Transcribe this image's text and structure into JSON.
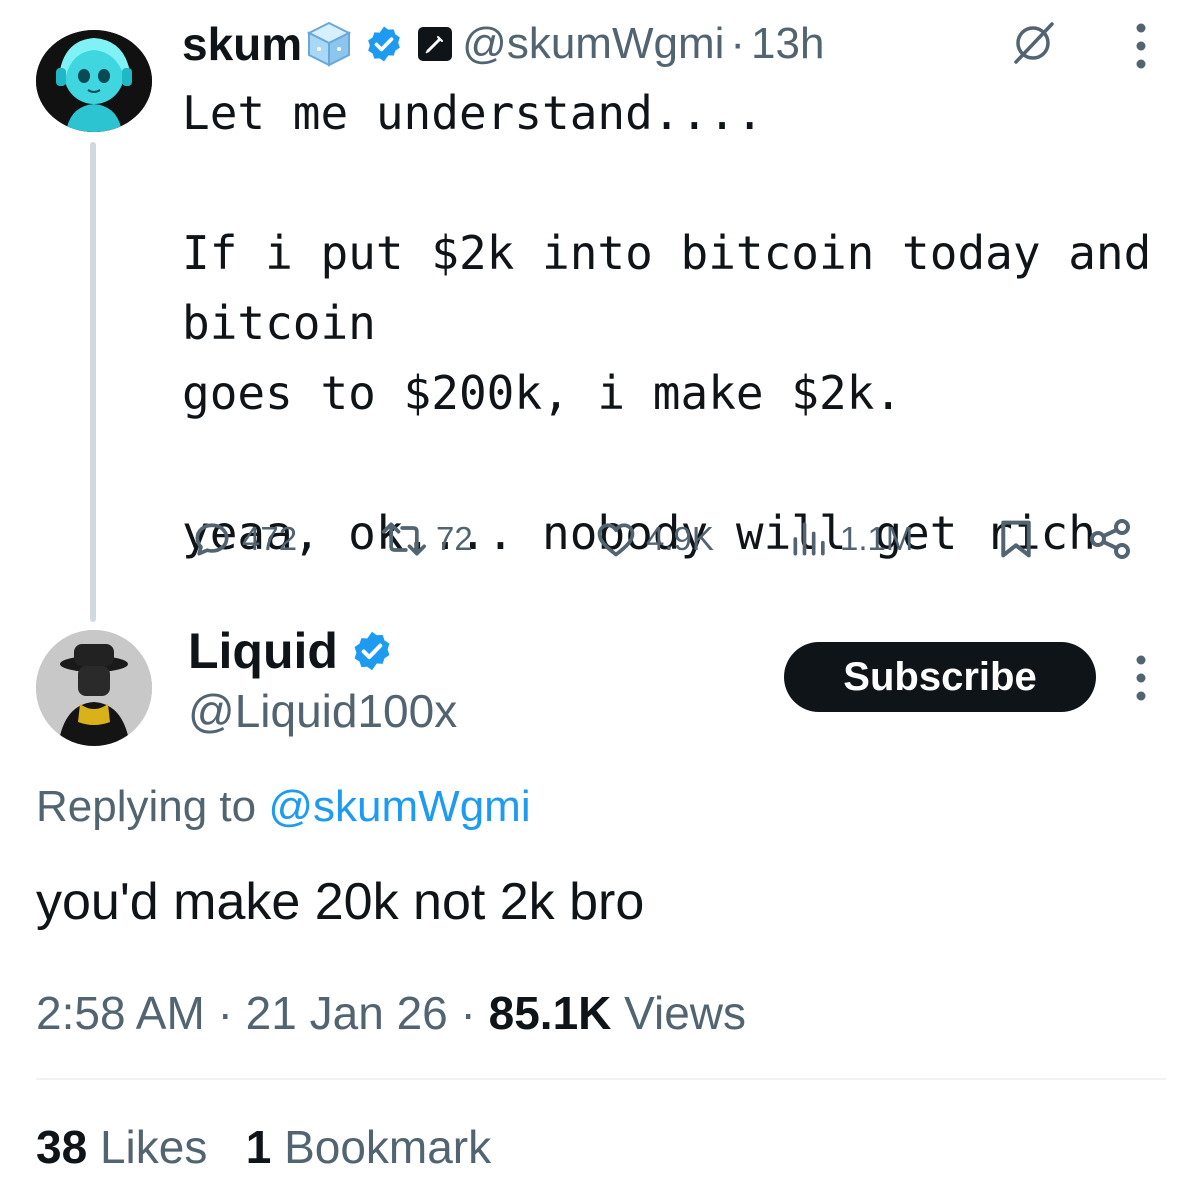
{
  "parent_tweet": {
    "display_name": "skum",
    "handle": "@skumWgmi",
    "separator": "·",
    "time": "13h",
    "text": "Let me understand....\n\nIf i put $2k into bitcoin today and bitcoin\ngoes to $200k, i make $2k.\n\nyeaa, ok.... nobody will get rich",
    "actions": {
      "replies": "472",
      "reposts": "72",
      "likes": "4.9K",
      "views": "1.1M"
    }
  },
  "reply_tweet": {
    "display_name": "Liquid",
    "handle": "@Liquid100x",
    "subscribe_label": "Subscribe",
    "replying_prefix": "Replying to",
    "replying_to": "@skumWgmi",
    "text": "you'd make 20k not 2k bro",
    "time": "2:58 AM",
    "date": "21 Jan 26",
    "separator": "·",
    "views_count": "85.1K",
    "views_label": "Views",
    "likes_count": "38",
    "likes_label": "Likes",
    "bookmarks_count": "1",
    "bookmarks_label": "Bookmark"
  },
  "colors": {
    "text_primary": "#0f1419",
    "text_secondary": "#536471",
    "accent": "#1d9bf0",
    "verified": "#1d9bf0",
    "thread_line": "#cfd9de",
    "avatar_glow": "#4de8f0"
  },
  "icons": {
    "cube_badge": "ice-cube-icon",
    "verified_badge": "verified-check-icon",
    "affiliate_badge": "affiliate-syringe-icon",
    "grok": "grok-icon",
    "more": "more-vertical-icon",
    "reply": "reply-bubble-icon",
    "repost": "repost-icon",
    "like": "heart-icon",
    "views": "analytics-bars-icon",
    "bookmark": "bookmark-icon",
    "share": "share-icon"
  }
}
